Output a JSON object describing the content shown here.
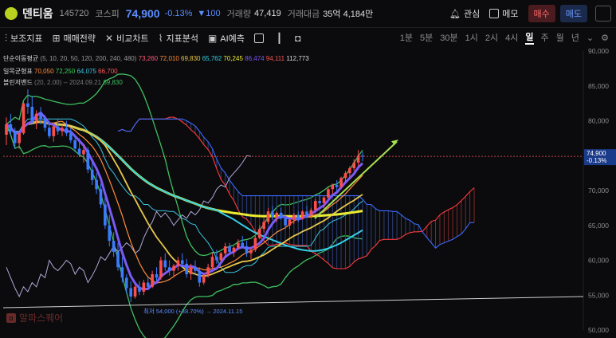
{
  "header": {
    "name": "덴티움",
    "code": "145720",
    "market": "코스피",
    "price": "74,900",
    "change_pct": "-0.13%",
    "change_abs": "▼100",
    "volume_label": "거래량",
    "volume": "47,419",
    "amount_label": "거래대금",
    "amount": "35억 4,184만",
    "favorite": "관심",
    "memo": "메모",
    "buy": "매수",
    "sell": "매도"
  },
  "toolbar": {
    "aux": "보조지표",
    "strategy": "매매전략",
    "compare": "비교차트",
    "tech": "지표분석",
    "ai": "AI예측",
    "periods": [
      "1분",
      "5분",
      "30분",
      "1시",
      "2시",
      "4시",
      "일",
      "주",
      "월",
      "년"
    ],
    "active_period": "일"
  },
  "legend": {
    "sma": {
      "name": "단순이동평균",
      "params": "(5, 10, 20, 50, 120, 200, 240, 480)",
      "values": [
        "73,260",
        "72,010",
        "69,830",
        "65,762",
        "70,245",
        "86,474",
        "94,111",
        "112,773"
      ]
    },
    "ichimoku": {
      "name": "일목균형표",
      "values": [
        "70,050",
        "72,250",
        "64,075",
        "66,700"
      ]
    },
    "bollinger": {
      "name": "볼린저밴드",
      "params": "(20, 2.00) -- 2024.09.21",
      "values": [
        "69,830"
      ]
    }
  },
  "watermark": "알파스퀘어",
  "colors": {
    "up": "#ff4d4d",
    "down": "#3a7bff",
    "bg": "#0b0b0d",
    "sma5": "#ff5a7a",
    "sma10": "#ff8c3a",
    "sma20": "#e8c84a",
    "sma50": "#35d0e8",
    "sma120": "#ecec30",
    "sma200": "#7a5af5",
    "sma240": "#ff5555",
    "sma480": "#2a5aff"
  },
  "chart_data": {
    "type": "candlestick",
    "ylim": [
      50000,
      90000
    ],
    "y_ticks": [
      "90,000",
      "85,000",
      "80,000",
      "75,000",
      "70,000",
      "65,000",
      "60,000",
      "55,000",
      "50,000"
    ],
    "current_price": "74,900",
    "current_change": "-0.13%",
    "low_annotation": "최저 54,000 (+38.70%) → 2024.11.15",
    "low_value": 54000,
    "candles": [
      [
        78000,
        80500,
        76500,
        79500
      ],
      [
        79500,
        81000,
        78000,
        78500
      ],
      [
        78500,
        79000,
        76000,
        76800
      ],
      [
        76800,
        78500,
        76000,
        78200
      ],
      [
        78200,
        83000,
        78000,
        82500
      ],
      [
        82500,
        84500,
        81000,
        82000
      ],
      [
        82000,
        83500,
        79500,
        80000
      ],
      [
        80000,
        81500,
        78800,
        81000
      ],
      [
        81000,
        82000,
        79500,
        80200
      ],
      [
        80200,
        80800,
        78500,
        79000
      ],
      [
        79000,
        80000,
        77500,
        77800
      ],
      [
        77800,
        79500,
        77000,
        79200
      ],
      [
        79200,
        80200,
        78000,
        78500
      ],
      [
        78500,
        79500,
        77800,
        79000
      ],
      [
        79000,
        80000,
        77800,
        78200
      ],
      [
        78200,
        79000,
        76800,
        77200
      ],
      [
        77200,
        78000,
        75500,
        76000
      ],
      [
        76000,
        77500,
        74800,
        75200
      ],
      [
        75200,
        76500,
        74000,
        75800
      ],
      [
        75800,
        76200,
        72500,
        73000
      ],
      [
        73000,
        74000,
        70800,
        71500
      ],
      [
        71500,
        72500,
        69500,
        70200
      ],
      [
        70200,
        71000,
        67500,
        68000
      ],
      [
        68000,
        69000,
        64500,
        65000
      ],
      [
        65000,
        66500,
        62000,
        62800
      ],
      [
        62800,
        64000,
        60500,
        61200
      ],
      [
        61200,
        62500,
        58500,
        59000
      ],
      [
        59000,
        60500,
        56800,
        57500
      ],
      [
        57500,
        58000,
        55200,
        56000
      ],
      [
        56000,
        57000,
        54000,
        54800
      ],
      [
        54800,
        56500,
        54500,
        56200
      ],
      [
        56200,
        57000,
        55000,
        55500
      ],
      [
        55500,
        57200,
        55000,
        56800
      ],
      [
        56800,
        57500,
        55800,
        56200
      ],
      [
        56200,
        58500,
        56000,
        58000
      ],
      [
        58000,
        59000,
        57000,
        57500
      ],
      [
        57500,
        60500,
        57200,
        60000
      ],
      [
        60000,
        61000,
        58500,
        59000
      ],
      [
        59000,
        60000,
        57800,
        58500
      ],
      [
        58500,
        59500,
        57500,
        59200
      ],
      [
        59200,
        60500,
        58500,
        60000
      ],
      [
        60000,
        61000,
        59000,
        59500
      ],
      [
        59500,
        60200,
        57500,
        58000
      ],
      [
        58000,
        59500,
        57200,
        59000
      ],
      [
        59000,
        60000,
        58000,
        58500
      ],
      [
        58500,
        59000,
        56200,
        56800
      ],
      [
        56800,
        58200,
        56500,
        57800
      ],
      [
        57800,
        59500,
        57500,
        59000
      ],
      [
        59000,
        61000,
        58800,
        60500
      ],
      [
        60500,
        61500,
        59500,
        60000
      ],
      [
        60000,
        61200,
        59800,
        61000
      ],
      [
        61000,
        62500,
        60500,
        62000
      ],
      [
        62000,
        62500,
        60800,
        61200
      ],
      [
        61200,
        62000,
        60500,
        61800
      ],
      [
        61800,
        63000,
        61500,
        62500
      ],
      [
        62500,
        63500,
        61800,
        62000
      ],
      [
        62000,
        62800,
        60500,
        61000
      ],
      [
        61000,
        61800,
        60200,
        61500
      ],
      [
        61500,
        63500,
        61200,
        63200
      ],
      [
        63200,
        65000,
        63000,
        64500
      ],
      [
        64500,
        66000,
        64000,
        65500
      ],
      [
        65500,
        67500,
        65200,
        67000
      ],
      [
        67000,
        67800,
        65800,
        66200
      ],
      [
        66200,
        67000,
        65500,
        66800
      ],
      [
        66800,
        67500,
        65800,
        66000
      ],
      [
        66000,
        66500,
        64500,
        65000
      ],
      [
        65000,
        66000,
        64500,
        65800
      ],
      [
        65800,
        66800,
        65200,
        66500
      ],
      [
        66500,
        67000,
        65500,
        66000
      ],
      [
        66000,
        67200,
        65800,
        67000
      ],
      [
        67000,
        67800,
        66000,
        66500
      ],
      [
        66500,
        67500,
        66000,
        67200
      ],
      [
        67200,
        68800,
        67000,
        68500
      ],
      [
        68500,
        69500,
        67800,
        68200
      ],
      [
        68200,
        69200,
        67500,
        69000
      ],
      [
        69000,
        70500,
        68800,
        70200
      ],
      [
        70200,
        71000,
        69500,
        70800
      ],
      [
        70800,
        71500,
        69800,
        70500
      ],
      [
        70500,
        72000,
        70200,
        71800
      ],
      [
        71800,
        72800,
        71200,
        72500
      ],
      [
        72500,
        73500,
        71800,
        73200
      ],
      [
        73200,
        74500,
        72800,
        74000
      ],
      [
        74000,
        75800,
        73500,
        75000
      ],
      [
        75000,
        75500,
        74200,
        74900
      ]
    ]
  }
}
